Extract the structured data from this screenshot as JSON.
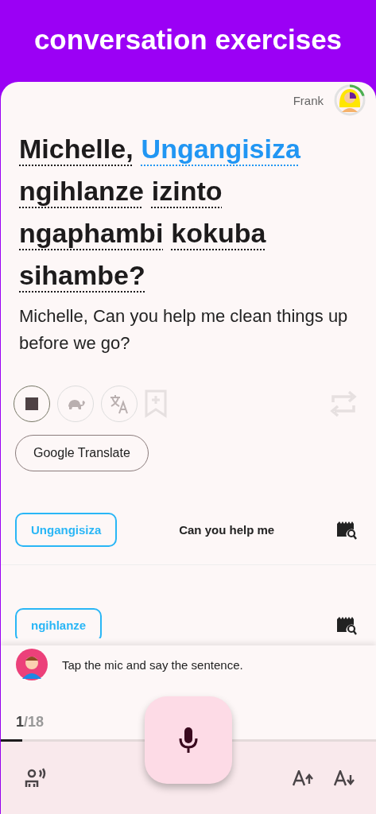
{
  "header": {
    "title": "conversation exercises"
  },
  "user": {
    "name": "Frank"
  },
  "sentence": {
    "words": [
      {
        "text": "Michelle,",
        "highlighted": false
      },
      {
        "text": "Ungangisiza",
        "highlighted": true
      },
      {
        "text": "ngihlanze",
        "highlighted": false
      },
      {
        "text": "izinto",
        "highlighted": false
      },
      {
        "text": "ngaphambi",
        "highlighted": false
      },
      {
        "text": "kokuba",
        "highlighted": false
      },
      {
        "text": "sihambe?",
        "highlighted": false
      }
    ],
    "translation": "Michelle, Can you help me clean things up before we go?"
  },
  "controls": [
    {
      "kind": "stop",
      "disabled": false
    },
    {
      "kind": "slow",
      "disabled": false
    },
    {
      "kind": "translate",
      "disabled": false
    },
    {
      "kind": "bookmark",
      "disabled": true
    },
    {
      "kind": "repeat",
      "disabled": true
    }
  ],
  "google_translate_button": "Google Translate",
  "vocabulary": [
    {
      "word": "Ungangisiza",
      "meaning": "Can you help me"
    },
    {
      "word": "ngihlanze"
    }
  ],
  "coach": {
    "message": "Tap the mic and say the sentence."
  },
  "progress": {
    "current": "1",
    "total": "/18",
    "level": 0.057
  },
  "bottom_bar": [
    {
      "kind": "voice"
    },
    {
      "kind": "mic"
    },
    {
      "kind": "font_increase"
    },
    {
      "kind": "font_decrease"
    }
  ]
}
